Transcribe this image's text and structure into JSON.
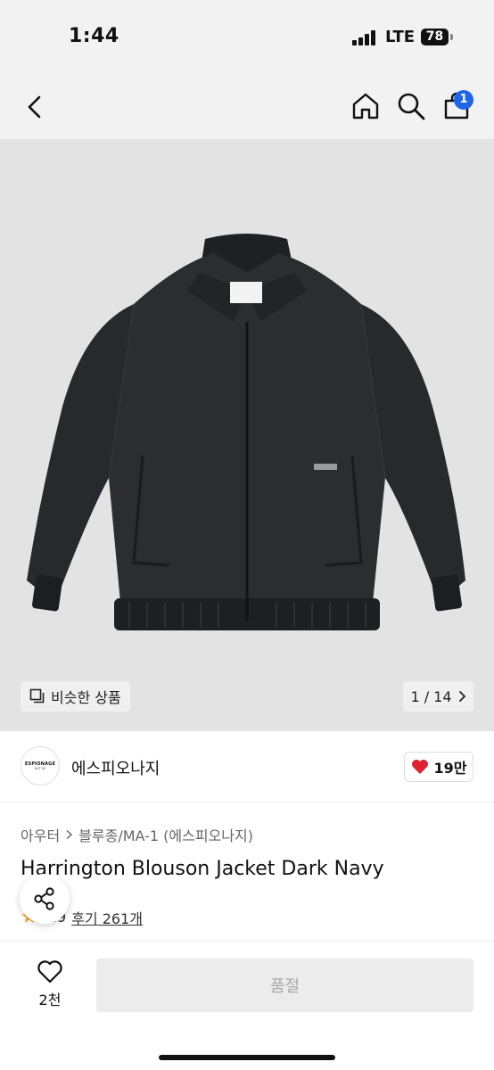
{
  "status_bar": {
    "time": "1:44",
    "network": "LTE",
    "battery": "78"
  },
  "nav": {
    "icons": [
      "back-icon",
      "home-icon",
      "search-icon",
      "cart-icon"
    ],
    "cart_badge": "1"
  },
  "gallery": {
    "similar_label": "비슷한 상품",
    "counter": "1 / 14"
  },
  "brand": {
    "logo_text": "ESPIONAGE",
    "logo_sub": "NST'90",
    "name": "에스피오나지",
    "likes": "19만"
  },
  "breadcrumb": {
    "category": "아우터",
    "subcategory": "블루종/MA-1 (에스피오나지)"
  },
  "product": {
    "title": "Harrington Blouson Jacket Dark Navy",
    "rating": "4.9",
    "reviews": "후기 261개"
  },
  "bottom": {
    "wish_count": "2천",
    "cta_label": "품절"
  },
  "colors": {
    "accent": "#1e66e8",
    "heart": "#e0202f",
    "star": "#f5a623",
    "jacket": "#2b2d31"
  }
}
